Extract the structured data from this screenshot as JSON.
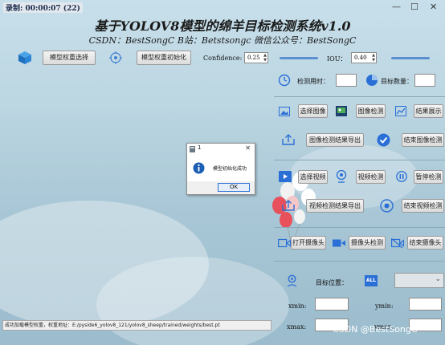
{
  "titlebar": {
    "timer": "录制: 00:00:07 (22)",
    "minimize": "—",
    "maximize": "☐",
    "close": "✕"
  },
  "header": {
    "title": "基于YOLOV8模型的绵羊目标检测系统v1.0",
    "subtitle": "CSDN：BestSongC   B站：Betstsongc   微信公众号：BestSongC"
  },
  "toolbar": {
    "select_weights": "模型权重选择",
    "init_model": "模型权重初始化",
    "confidence_label": "Confidence:",
    "confidence_value": "0.25",
    "iou_label": "IOU：",
    "iou_value": "0.40",
    "confidence_level": 0.25,
    "iou_level": 0.4
  },
  "panel": {
    "detect_time_label": "检测用时：",
    "target_count_label": "目标数量：",
    "select_image": "选择图像",
    "image_detect": "图像检测",
    "show_result": "结果展示",
    "export_image_result": "图像检测结果导出",
    "end_image_detect": "结束图像检测",
    "select_video": "选择视频",
    "video_detect": "视频检测",
    "pause_detect": "暂停检测",
    "export_video_result": "视频检测结果导出",
    "end_video_detect": "结束视频检测",
    "open_camera": "打开摄像头",
    "camera_detect": "摄像头检测",
    "end_camera": "结束摄像头",
    "target_position_label": "目标位置：",
    "all_badge": "ALL",
    "xmin_label": "xmin:",
    "ymin_label": "ymin:",
    "xmax_label": "xmax:",
    "ymax_label": "ymax:"
  },
  "status": {
    "text": "成功加载模型权重，权重地址：E:/pyside6_yolov8_121/yolov8_sheep/trained/weights/best.pt"
  },
  "dialog": {
    "title": "1",
    "message": "模型初始化成功",
    "ok": "OK",
    "close": "✕"
  },
  "watermark": "CSDN @BestSongC",
  "colors": {
    "accent_blue": "#2a6fd6",
    "slider_blue": "#5b8fd0",
    "info_blue": "#1a5fb4"
  }
}
